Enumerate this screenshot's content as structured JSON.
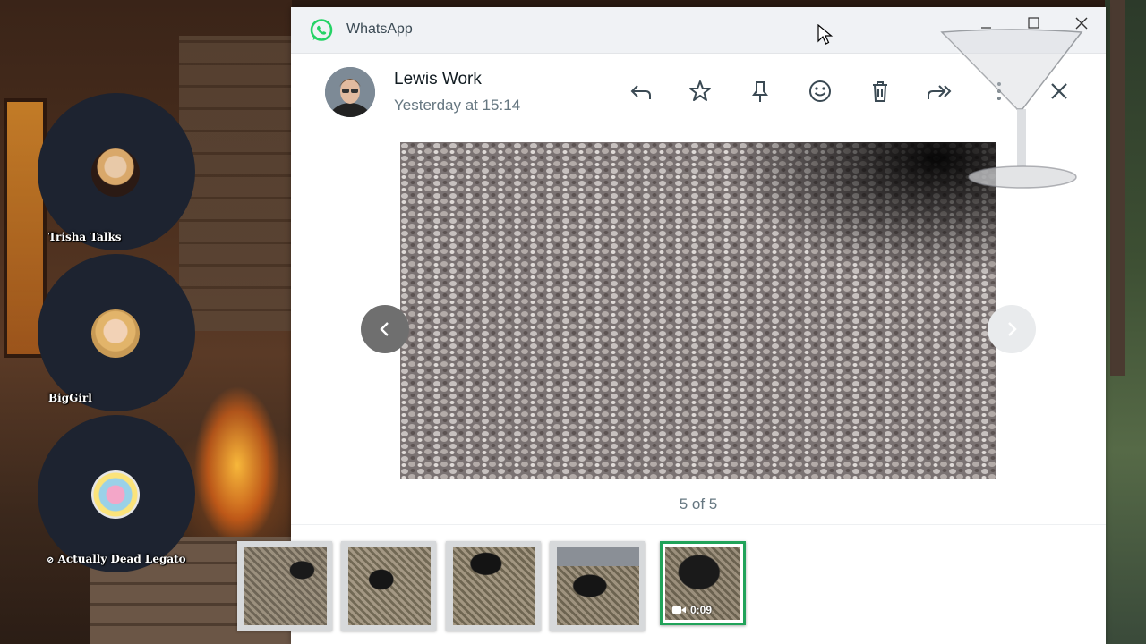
{
  "app": {
    "title": "WhatsApp",
    "logo_icon": "whatsapp-logo-icon",
    "accent": "#25d366"
  },
  "window_controls": {
    "minimize": "minimize-icon",
    "maximize": "maximize-icon",
    "close": "close-icon"
  },
  "participants": [
    {
      "name": "Trisha Talks"
    },
    {
      "name": "BigGirl"
    },
    {
      "name": "Actually Dead Legato",
      "muted": true
    }
  ],
  "viewer": {
    "sender": {
      "name": "Lewis Work",
      "time": "Yesterday at 15:14"
    },
    "toolbar": [
      "reply-icon",
      "star-icon",
      "pin-icon",
      "emoji-icon",
      "delete-icon",
      "forward-icon",
      "more-icon",
      "close-icon"
    ],
    "counter": "5 of 5",
    "position": {
      "current": 5,
      "total": 5
    },
    "thumbnails": [
      {
        "type": "image"
      },
      {
        "type": "image"
      },
      {
        "type": "image"
      },
      {
        "type": "image"
      },
      {
        "type": "video",
        "duration": "0:09",
        "selected": true
      }
    ],
    "selected_border_color": "#21a35a"
  }
}
